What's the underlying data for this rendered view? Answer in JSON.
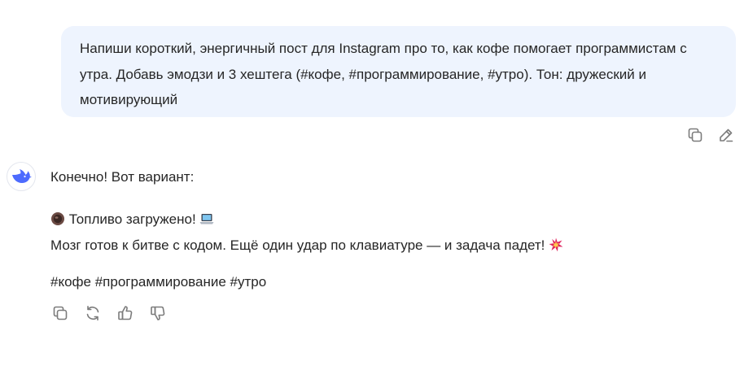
{
  "user_message": {
    "text": "Напиши короткий, энергичный пост для Instagram про то, как кофе помогает программистам с утра. Добавь эмодзи и 3 хештега (#кофе, #программирование, #утро). Тон: дружеский и мотивирующий",
    "actions": [
      {
        "icon": "copy-icon"
      },
      {
        "icon": "edit-icon"
      }
    ]
  },
  "assistant_message": {
    "avatar_icon": "deepseek-whale-icon",
    "intro": "Конечно! Вот вариант:",
    "line1_text": "Топливо загружено!",
    "line1_emoji_start": "coffee-cup-emoji",
    "line1_emoji_end": "laptop-emoji",
    "line2_text": "Мозг готов к битве с кодом. Ещё один удар по клавиатуре — и задача падет!",
    "line2_emoji_end": "collision-emoji",
    "hashtags": "#кофе #программирование #утро",
    "actions": [
      {
        "icon": "copy-icon"
      },
      {
        "icon": "regenerate-icon"
      },
      {
        "icon": "thumbs-up-icon"
      },
      {
        "icon": "thumbs-down-icon"
      }
    ]
  },
  "colors": {
    "user_bubble_bg": "#eef4fe",
    "text": "#262626",
    "icon": "#7b7b7b",
    "brand": "#4d6bfe"
  }
}
